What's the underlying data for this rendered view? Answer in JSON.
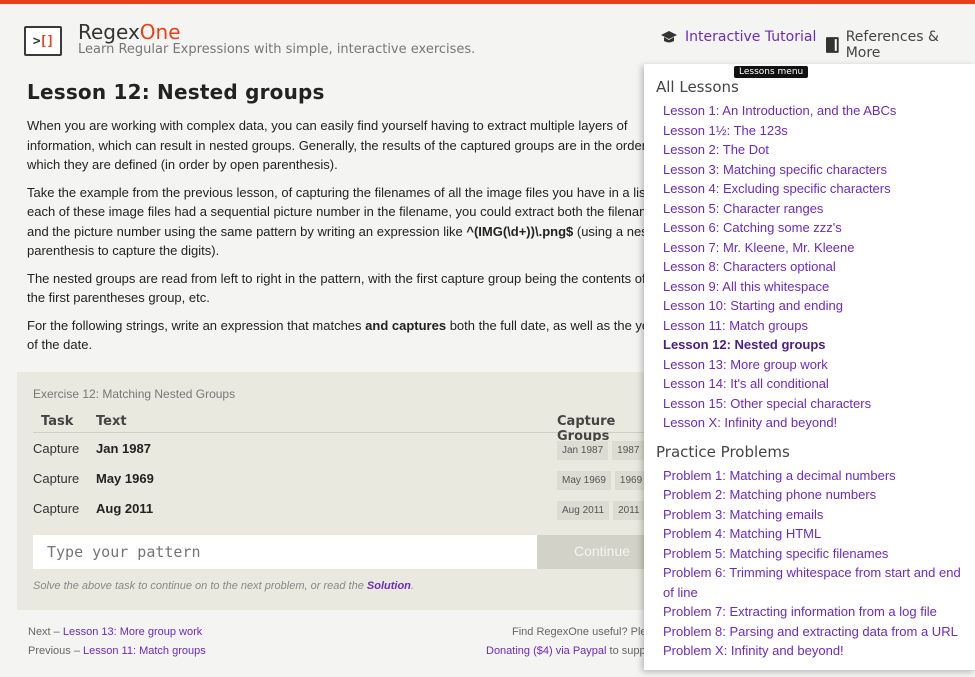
{
  "header": {
    "brand_regex": "Regex",
    "brand_one": "One",
    "tagline": "Learn Regular Expressions with simple, interactive exercises.",
    "nav_tutorial": "Interactive Tutorial",
    "nav_references": "References & More",
    "tooltip": "Lessons menu"
  },
  "lesson": {
    "title": "Lesson 12: Nested groups",
    "p1": "When you are working with complex data, you can easily find yourself having to extract multiple layers of information, which can result in nested groups. Generally, the results of the captured groups are in the order in which they are defined (in order by open parenthesis).",
    "p2_a": "Take the example from the previous lesson, of capturing the filenames of all the image files you have in a list. If each of these image files had a sequential picture number in the filename, you could extract both the filename and the picture number using the same pattern by writing an expression like ",
    "p2_code": "^(IMG(\\d+))\\.png$",
    "p2_b": " (using a nested parenthesis to capture the digits).",
    "p3": "The nested groups are read from left to right in the pattern, with the first capture group being the contents of the first parentheses group, etc.",
    "p4_a": "For the following strings, write an expression that matches ",
    "p4_bold": "and captures",
    "p4_b": " both the full date, as well as the year of the date."
  },
  "exercise": {
    "title": "Exercise 12: Matching Nested Groups",
    "col_task": "Task",
    "col_text": "Text",
    "col_groups": "Capture Groups",
    "rows": [
      {
        "task": "Capture",
        "text": "Jan 1987",
        "groups": [
          "Jan 1987",
          "1987"
        ]
      },
      {
        "task": "Capture",
        "text": "May 1969",
        "groups": [
          "May 1969",
          "1969"
        ]
      },
      {
        "task": "Capture",
        "text": "Aug 2011",
        "groups": [
          "Aug 2011",
          "2011"
        ]
      }
    ],
    "input_placeholder": "Type your pattern",
    "continue_label": "Continue",
    "hint_text": "Solve the above task to continue on to the next problem, or read the ",
    "hint_link": "Solution",
    "hint_end": "."
  },
  "footer": {
    "next_prefix": "Next – ",
    "next_link": "Lesson 13: More group work",
    "prev_prefix": "Previous – ",
    "prev_link": "Lesson 11: Match groups",
    "useful": "Find RegexOne useful? Please consider",
    "donate_link": "Donating ($4) via Paypal",
    "donate_suffix": " to support our site."
  },
  "menu": {
    "lessons_heading": "All Lessons",
    "lessons": [
      "Lesson 1: An Introduction, and the ABCs",
      "Lesson 1½: The 123s",
      "Lesson 2: The Dot",
      "Lesson 3: Matching specific characters",
      "Lesson 4: Excluding specific characters",
      "Lesson 5: Character ranges",
      "Lesson 6: Catching some zzz's",
      "Lesson 7: Mr. Kleene, Mr. Kleene",
      "Lesson 8: Characters optional",
      "Lesson 9: All this whitespace",
      "Lesson 10: Starting and ending",
      "Lesson 11: Match groups",
      "Lesson 12: Nested groups",
      "Lesson 13: More group work",
      "Lesson 14: It's all conditional",
      "Lesson 15: Other special characters",
      "Lesson X: Infinity and beyond!"
    ],
    "active_index": 12,
    "problems_heading": "Practice Problems",
    "problems": [
      "Problem 1: Matching a decimal numbers",
      "Problem 2: Matching phone numbers",
      "Problem 3: Matching emails",
      "Problem 4: Matching HTML",
      "Problem 5: Matching specific filenames",
      "Problem 6: Trimming whitespace from start and end of line",
      "Problem 7: Extracting information from a log file",
      "Problem 8: Parsing and extracting data from a URL",
      "Problem X: Infinity and beyond!"
    ]
  },
  "colors": {
    "accent": "#e8411a",
    "link": "#6c2bc0"
  },
  "icons": {
    "logo": "regex-bracket-logo",
    "tutorial": "graduation-cap-icon",
    "references": "book-icon"
  }
}
